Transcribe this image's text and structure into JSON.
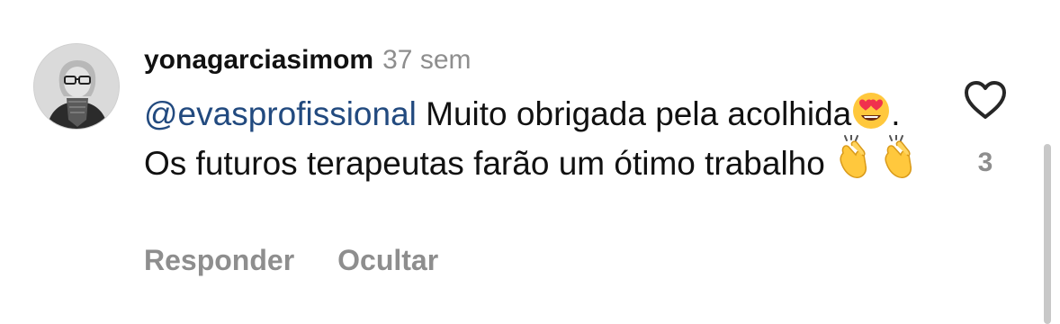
{
  "comment": {
    "username": "yonagarciasimom",
    "time": "37 sem",
    "mention": "@evasprofissional",
    "text_part1": " Muito obrigada pela acolhida",
    "text_part2": ". Os futuros terapeutas farão um ótimo trabalho ",
    "emojis": {
      "first": "heart-eyes-emoji",
      "clap": "clapping-hands-emoji"
    },
    "like_count": "3"
  },
  "actions": {
    "reply_label": "Responder",
    "hide_label": "Ocultar"
  },
  "icons": {
    "like": "heart-outline-icon",
    "avatar": "profile-avatar"
  },
  "colors": {
    "text": "#111111",
    "secondary": "#8e8e8e",
    "mention": "#224a7f",
    "emoji_yellow": "#ffc83d",
    "emoji_heart": "#f0314e"
  }
}
